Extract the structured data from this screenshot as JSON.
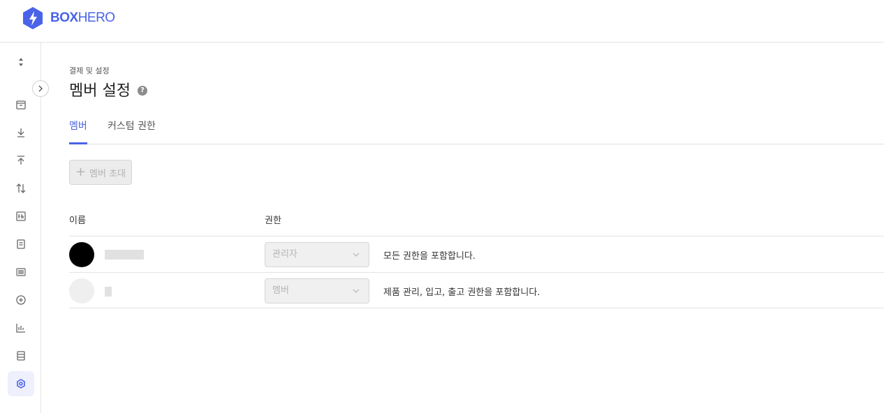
{
  "brand": {
    "name_bold": "BOX",
    "name_light": "HERO",
    "color": "#4a63e8"
  },
  "sidebar": {
    "icons": [
      "sort-arrows-icon",
      "package-icon",
      "download-icon",
      "upload-icon",
      "transfer-icon",
      "adjust-icon",
      "document-icon",
      "barcode-icon",
      "plus-circle-icon",
      "bar-chart-icon",
      "database-icon",
      "gear-icon"
    ],
    "active": "gear-icon"
  },
  "page": {
    "breadcrumb": "결제 및 설정",
    "title": "멤버 설정",
    "help": "?"
  },
  "tabs": [
    {
      "label": "멤버",
      "active": true
    },
    {
      "label": "커스텀 권한",
      "active": false
    }
  ],
  "invite_button": {
    "icon": "+",
    "label": "멤버 초대"
  },
  "table": {
    "headers": {
      "name": "이름",
      "role": "권한"
    },
    "rows": [
      {
        "role": "관리자",
        "description": "모든 권한을 포함합니다."
      },
      {
        "role": "멤버",
        "description": "제품 관리, 입고, 출고 권한을 포함합니다."
      }
    ]
  }
}
